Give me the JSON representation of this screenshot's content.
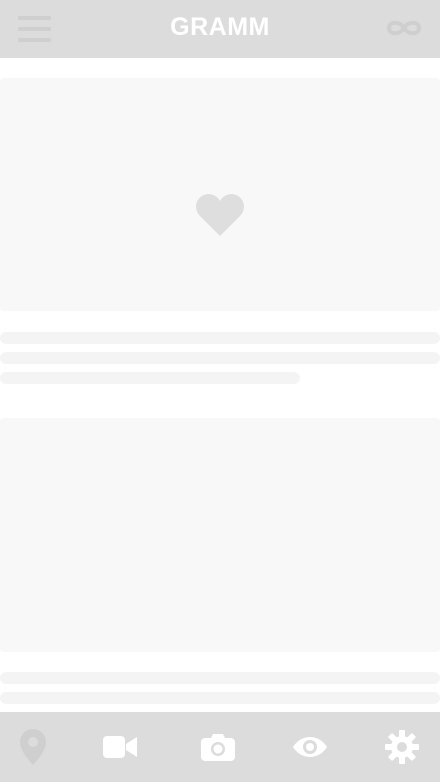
{
  "header": {
    "title": "GRAMM",
    "menu_icon": "hamburger-menu-icon",
    "right_icon": "infinity-icon"
  },
  "feed": {
    "placeholder_icon": "heart-icon",
    "skeleton": "loading"
  },
  "bottom_nav": {
    "items": [
      {
        "icon": "location-pin-icon"
      },
      {
        "icon": "video-camera-icon"
      },
      {
        "icon": "photo-camera-icon"
      },
      {
        "icon": "eye-icon"
      },
      {
        "icon": "gear-icon"
      }
    ]
  },
  "colors": {
    "bar_background": "#dcdcdc",
    "icon_white": "#ffffff",
    "icon_faded": "#cfcfcf",
    "placeholder_fill": "#f8f8f8",
    "heart": "#dedede"
  }
}
